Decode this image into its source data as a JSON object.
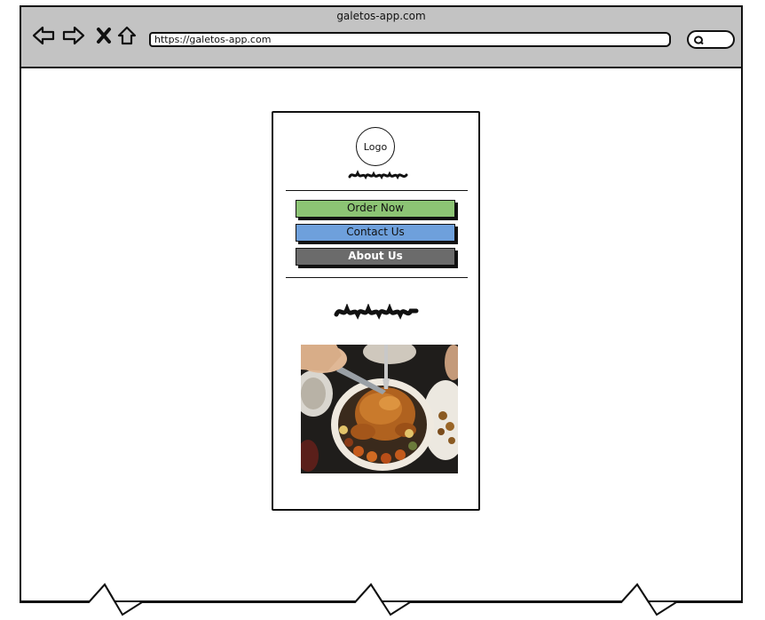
{
  "browser": {
    "window_title": "galetos-app.com",
    "url": "https://galetos-app.com",
    "nav_icons": [
      "back-arrow-icon",
      "forward-arrow-icon",
      "close-x-icon",
      "home-icon"
    ],
    "search_icon": "search-icon"
  },
  "mobile": {
    "logo_label": "Logo",
    "menu": [
      {
        "label": "Order Now",
        "color": "#8cc474"
      },
      {
        "label": "Contact Us",
        "color": "#6ea0dc"
      },
      {
        "label": "About Us",
        "color": "#6b6b6b"
      }
    ],
    "hero_image": "roast-chicken-dinner-photo"
  }
}
